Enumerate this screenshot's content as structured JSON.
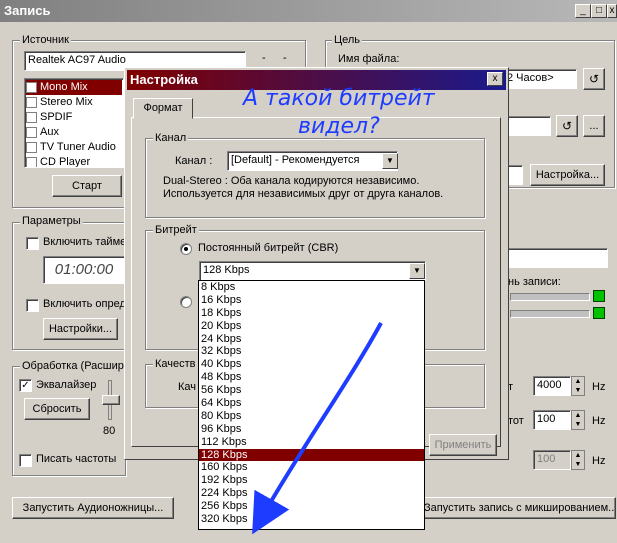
{
  "window": {
    "title": "Запись",
    "btn_min": "_",
    "btn_max": "□",
    "btn_close": "x"
  },
  "source": {
    "label": "Источник",
    "device": "Realtek AC97 Audio",
    "items": [
      "Mono Mix",
      "Stereo Mix",
      "SPDIF",
      "Aux",
      "TV Tuner Audio",
      "CD Player"
    ],
    "selected_index": 0,
    "start_button": "Старт",
    "minus": "-"
  },
  "target": {
    "label": "Цель",
    "filename_label": "Имя файла:",
    "time_value": "2 Часов>",
    "settings_button": "Настройка...",
    "more_button": "..."
  },
  "params": {
    "label": "Параметры",
    "timer_label": "Включить тайме",
    "time": "01:00:00",
    "detect_label": "Включить опред",
    "settings_button": "Настройки..."
  },
  "processing": {
    "label": "Обработка (Расшире",
    "eq_label": "Эквалайзер",
    "reset_button": "Сбросить",
    "slider_value": "80",
    "write_freq_label": "Писать частоты"
  },
  "right": {
    "record_level_label": "нь записи:",
    "freq1_label": "т",
    "freq1": "4000",
    "freq2_label": "тот",
    "freq2": "100",
    "freq3": "100",
    "hz": "Hz"
  },
  "bottom": {
    "launch_button": "Запустить Аудионожницы...",
    "mix_button": "Запустить запись с микшированием..."
  },
  "dialog": {
    "title": "Настройка",
    "close": "x",
    "tab": "Формат",
    "channel_group": "Канал",
    "channel_label": "Канал :",
    "channel_value": "[Default] - Рекомендуется",
    "desc_line1": "Dual-Stereo : Оба канала кодируются независимо.",
    "desc_line2": "Используется для независимых друг от друга каналов.",
    "bitrate_group": "Битрейт",
    "cbr_label": "Постоянный битрейт (CBR)",
    "bitrate_value": "128 Kbps",
    "quality_group": "Качеств",
    "quality_label": "Кач",
    "apply_button": "Применить"
  },
  "bitrate_options": [
    "8 Kbps",
    "16 Kbps",
    "18 Kbps",
    "20 Kbps",
    "24 Kbps",
    "32 Kbps",
    "40 Kbps",
    "48 Kbps",
    "56 Kbps",
    "64 Kbps",
    "80 Kbps",
    "96 Kbps",
    "112 Kbps",
    "128 Kbps",
    "160 Kbps",
    "192 Kbps",
    "224 Kbps",
    "256 Kbps",
    "320 Kbps"
  ],
  "bitrate_selected_index": 13,
  "annotation": {
    "line1": "А такой битрейт",
    "line2": "видел?",
    "color": "#1e3cff"
  },
  "accent_color": "#800000"
}
